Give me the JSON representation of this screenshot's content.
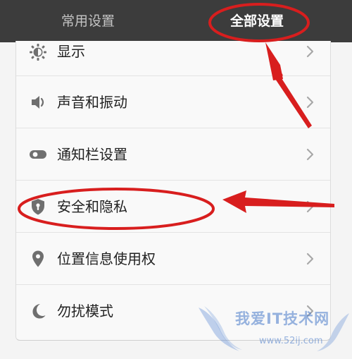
{
  "tabs": {
    "common_label": "常用设置",
    "all_label": "全部设置",
    "active": "all"
  },
  "settings": {
    "items": [
      {
        "label": "显示",
        "icon": "display-brightness-icon"
      },
      {
        "label": "声音和振动",
        "icon": "speaker-icon"
      },
      {
        "label": "通知栏设置",
        "icon": "toggle-icon"
      },
      {
        "label": "安全和隐私",
        "icon": "shield-icon"
      },
      {
        "label": "位置信息使用权",
        "icon": "location-pin-icon"
      },
      {
        "label": "勿扰模式",
        "icon": "moon-icon"
      }
    ]
  },
  "annotations": {
    "color": "#d81e1e",
    "highlighted": [
      "全部设置",
      "安全和隐私"
    ]
  },
  "watermark": {
    "text": "我爱IT技术网",
    "url": "www.52ij.com"
  },
  "colors": {
    "tab_bar": "#3c3c3c",
    "tab_inactive_text": "#c4c4c4",
    "tab_active_text": "#ffffff",
    "card_background": "#f9f9f9",
    "icon": "#6f6f6f",
    "chevron": "#a8a8a8"
  }
}
